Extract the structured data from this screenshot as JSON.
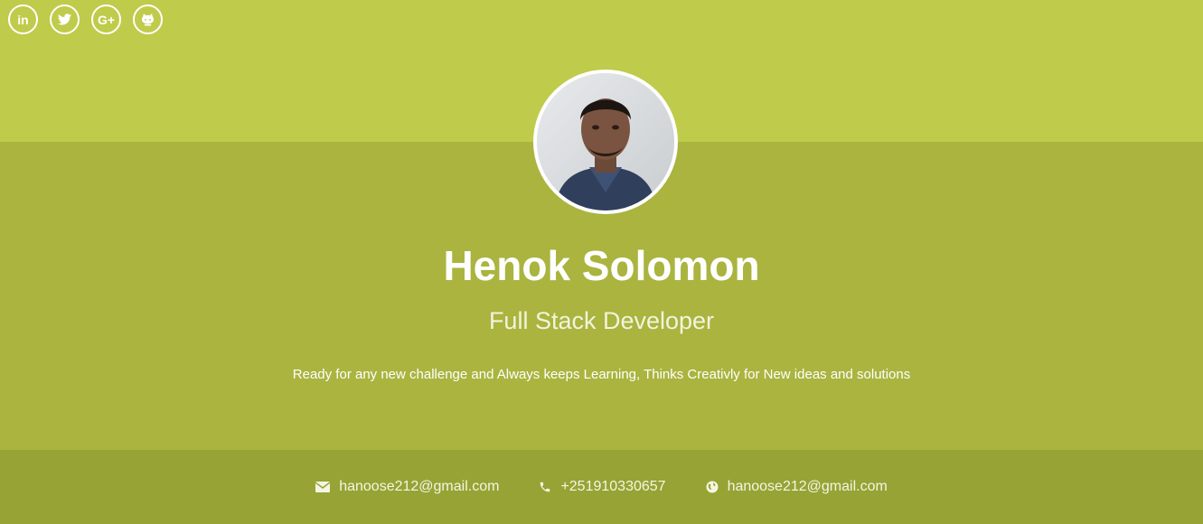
{
  "colors": {
    "top": "#bfcb4a",
    "middle": "#aab43f",
    "bottom": "#97a335",
    "text": "#ffffff"
  },
  "social": [
    {
      "icon": "linkedin-icon",
      "label": "in"
    },
    {
      "icon": "twitter-icon"
    },
    {
      "icon": "google-plus-icon",
      "label": "G+"
    },
    {
      "icon": "github-icon"
    }
  ],
  "profile": {
    "name": "Henok Solomon",
    "title": "Full Stack Developer",
    "bio": "Ready for any new challenge and Always keeps Learning, Thinks Creativly for New ideas and solutions"
  },
  "contact": {
    "email": "hanoose212@gmail.com",
    "phone": "+251910330657",
    "website": "hanoose212@gmail.com"
  }
}
